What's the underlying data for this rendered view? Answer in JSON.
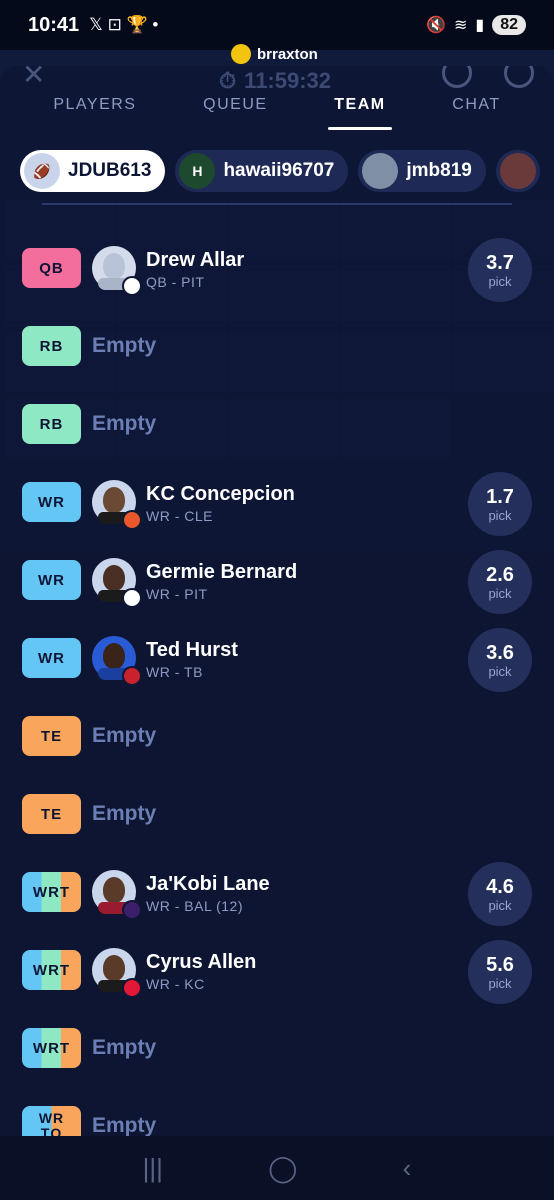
{
  "status_bar": {
    "time": "10:41",
    "left_icons": "𝕏 ⊡ 🏆 •",
    "battery": "82"
  },
  "header": {
    "username": "brraxton",
    "timer": "11:59:32"
  },
  "tabs": [
    {
      "label": "PLAYERS",
      "active": false
    },
    {
      "label": "QUEUE",
      "active": false
    },
    {
      "label": "TEAM",
      "active": true
    },
    {
      "label": "CHAT",
      "active": false
    }
  ],
  "teams": [
    {
      "label": "JDUB613",
      "active": true,
      "avatar": "helmet"
    },
    {
      "label": "hawaii96707",
      "active": false,
      "avatar": "H"
    },
    {
      "label": "jmb819",
      "active": false,
      "avatar": "photo"
    }
  ],
  "roster": [
    {
      "pos": "QB",
      "player": "Drew Allar",
      "info": "QB - PIT",
      "pick": "3.7",
      "pick_label": "pick"
    },
    {
      "pos": "RB",
      "empty": "Empty"
    },
    {
      "pos": "RB",
      "empty": "Empty"
    },
    {
      "pos": "WR",
      "player": "KC Concepcion",
      "info": "WR - CLE",
      "pick": "1.7",
      "pick_label": "pick"
    },
    {
      "pos": "WR",
      "player": "Germie Bernard",
      "info": "WR - PIT",
      "pick": "2.6",
      "pick_label": "pick"
    },
    {
      "pos": "WR",
      "player": "Ted Hurst",
      "info": "WR - TB",
      "pick": "3.6",
      "pick_label": "pick"
    },
    {
      "pos": "TE",
      "empty": "Empty"
    },
    {
      "pos": "TE",
      "empty": "Empty"
    },
    {
      "pos": "WRT",
      "player": "Ja'Kobi Lane",
      "info": "WR - BAL (12)",
      "pick": "4.6",
      "pick_label": "pick"
    },
    {
      "pos": "WRT",
      "player": "Cyrus Allen",
      "info": "WR - KC",
      "pick": "5.6",
      "pick_label": "pick"
    },
    {
      "pos": "WRT",
      "empty": "Empty"
    },
    {
      "pos_line1": "WR",
      "pos_line2": "TQ",
      "empty": "Empty"
    }
  ],
  "colors": {
    "qb": "#f36d9d",
    "rb": "#8ee8c4",
    "wr": "#63c6f5",
    "te": "#f9a65c",
    "background": "#0b1126"
  },
  "bottom_nav": {
    "recents": "|||",
    "home": "◯",
    "back": "‹"
  }
}
